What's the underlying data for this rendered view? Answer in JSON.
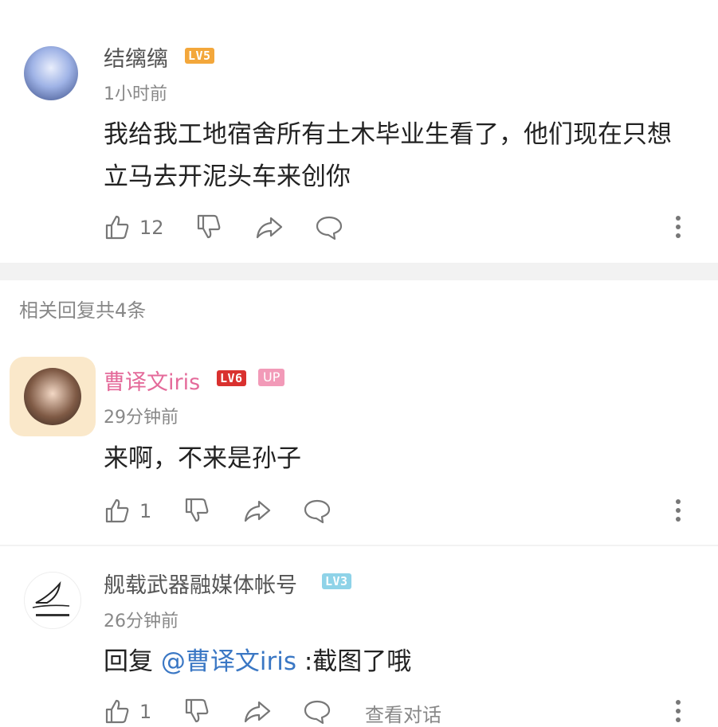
{
  "main_comment": {
    "username": "结缡缡",
    "level": "LV5",
    "time": "1小时前",
    "content": "我给我工地宿舍所有土木毕业生看了，他们现在只想立马去开泥头车来创你",
    "like_count": "12"
  },
  "replies_header": "相关回复共4条",
  "replies": [
    {
      "username": "曹译文iris",
      "level": "LV6",
      "badge": "UP",
      "time": "29分钟前",
      "content": "来啊，不来是孙子",
      "like_count": "1"
    },
    {
      "username": "舰载武器融媒体帐号",
      "level": "LV3",
      "time": "26分钟前",
      "reply_prefix": "回复",
      "mention": "@曹译文iris",
      "content": " :截图了哦",
      "like_count": "1",
      "view_conversation": "查看对话"
    }
  ],
  "colors": {
    "vip_name": "#e46a9a",
    "link": "#3a77c4",
    "lv5": "#f3a73b",
    "lv6": "#d9312f",
    "lv3": "#8fd3e8"
  }
}
